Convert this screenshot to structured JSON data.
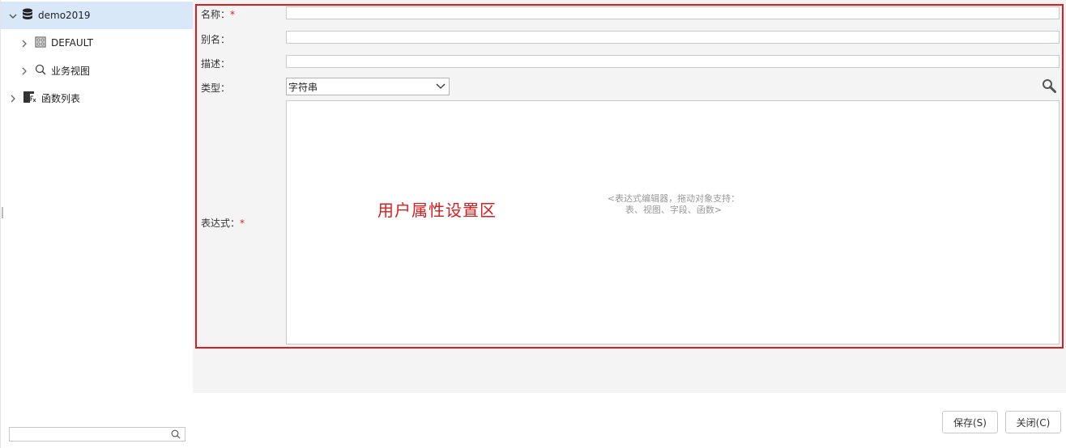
{
  "tree": {
    "items": [
      {
        "label": "demo2019",
        "icon": "database-icon",
        "expanded": true,
        "selected": true
      },
      {
        "label": "DEFAULT",
        "icon": "schema-icon",
        "expanded": false
      },
      {
        "label": "业务视图",
        "icon": "search-icon",
        "expanded": false
      },
      {
        "label": "函数列表",
        "icon": "function-list-icon",
        "expanded": false
      }
    ],
    "search": {
      "placeholder": ""
    }
  },
  "form": {
    "name_label": "名称：",
    "alias_label": "别名：",
    "desc_label": "描述：",
    "type_label": "类型：",
    "expr_label": "表达式：",
    "required_mark": "*",
    "name_value": "",
    "alias_value": "",
    "desc_value": "",
    "type_value": "字符串",
    "expr_hint_line1": "<表达式编辑器，拖动对象支持：",
    "expr_hint_line2": "表、视图、字段、函数>",
    "zone_label": "用户属性设置区"
  },
  "footer": {
    "save_label": "保存(S)",
    "close_label": "关闭(C)"
  },
  "colors": {
    "accent_red": "#d81e1e",
    "selected_bg": "#d9e8f9"
  }
}
